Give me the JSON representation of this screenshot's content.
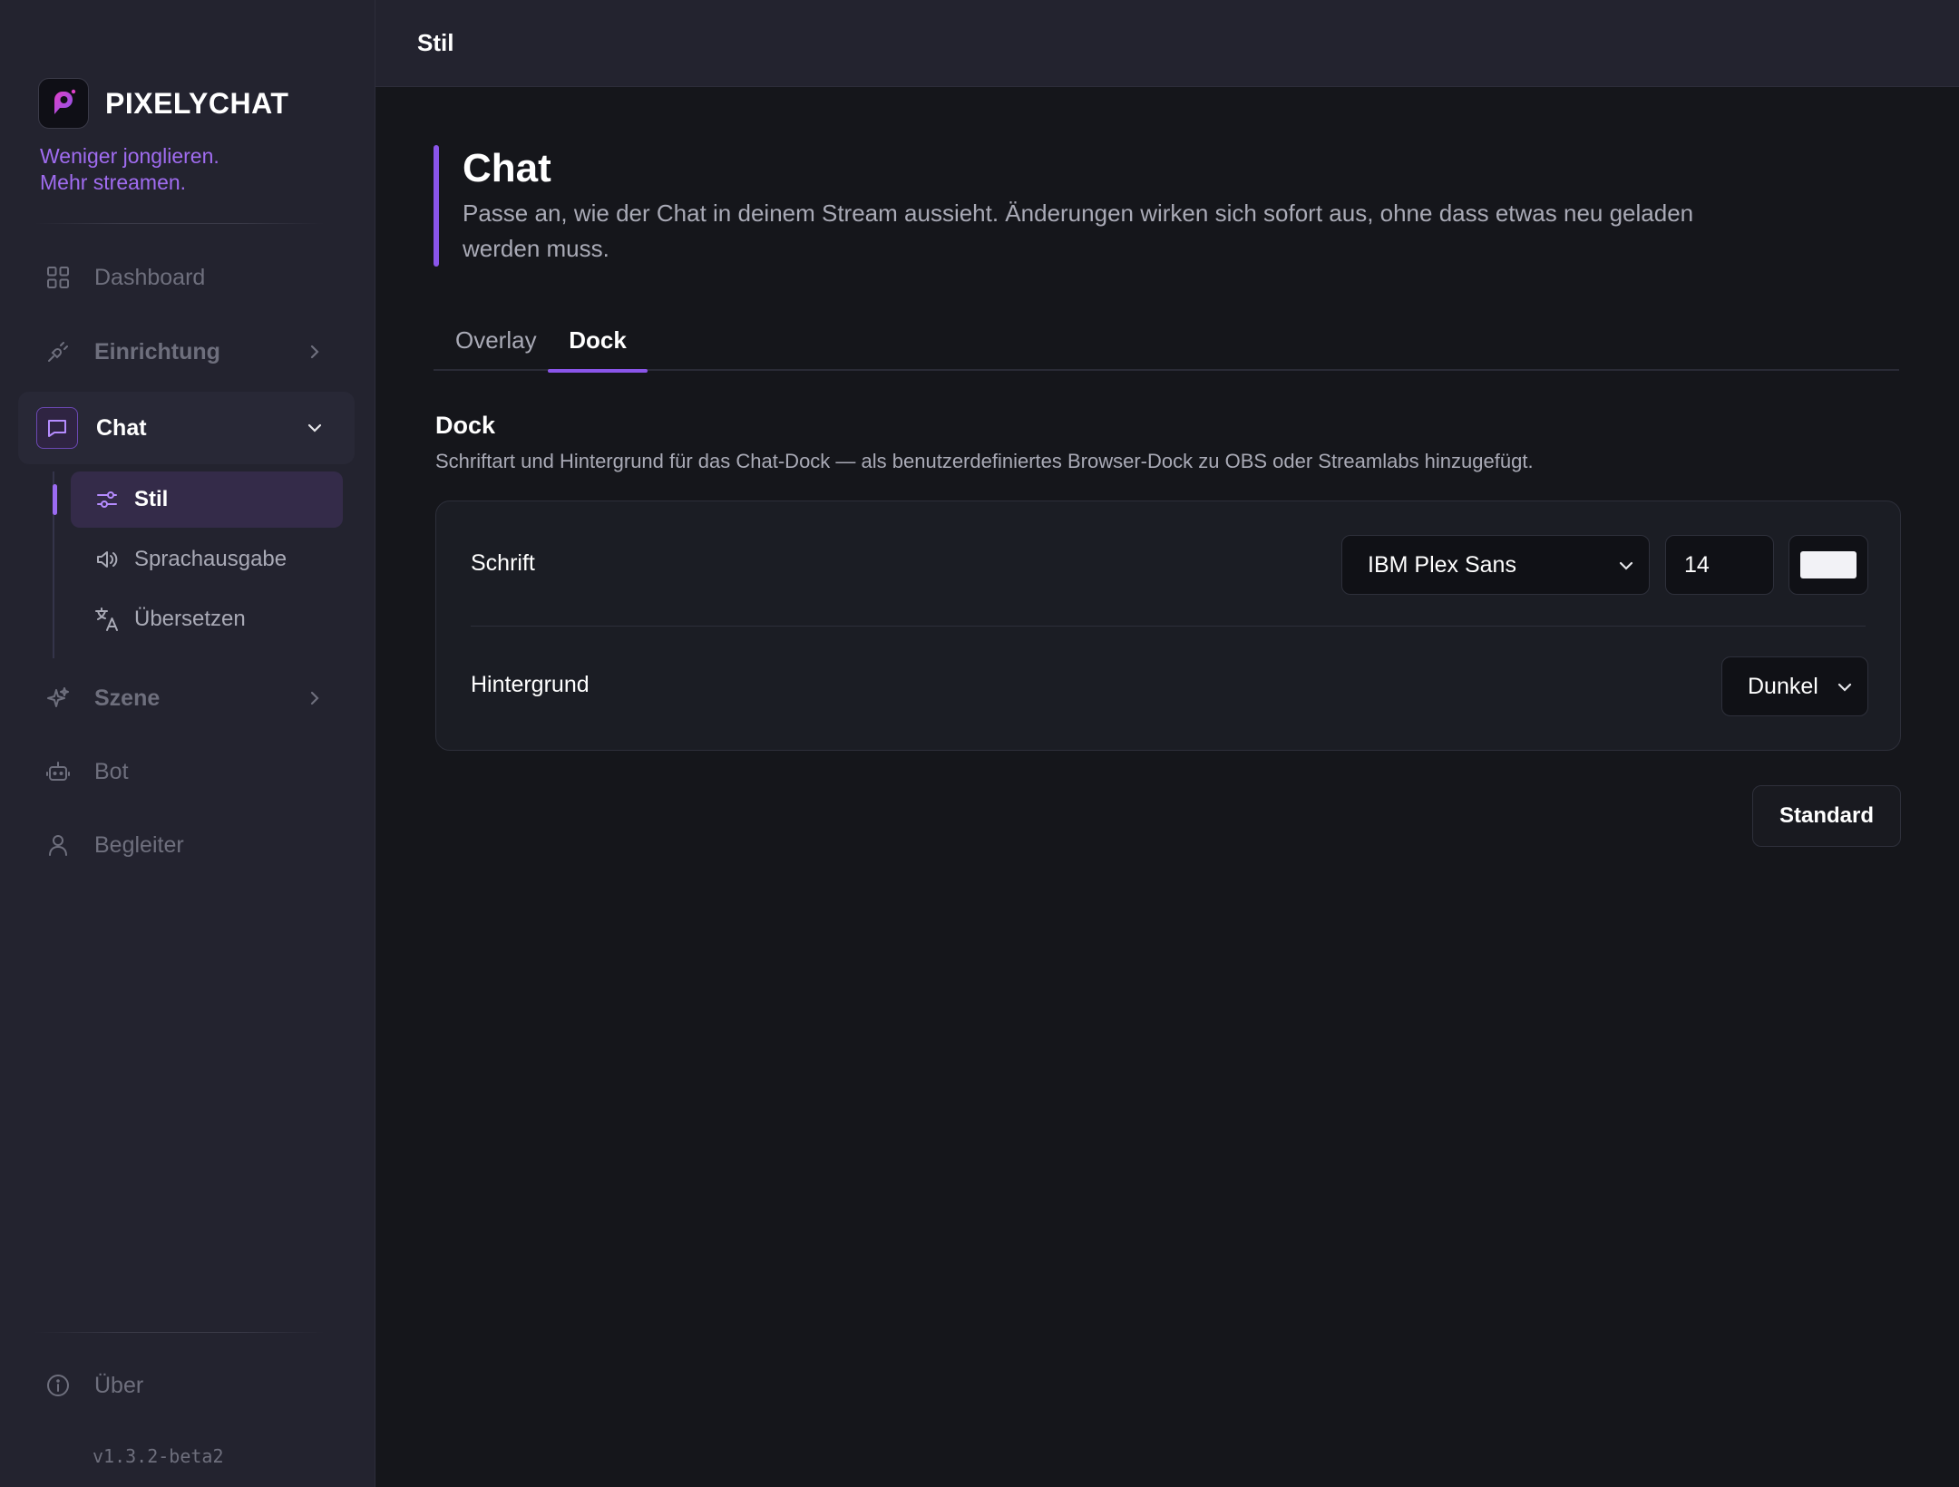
{
  "brand": {
    "name": "PIXELYCHAT",
    "tagline_line1": "Weniger jonglieren.",
    "tagline_line2": "Mehr streamen.",
    "accent_color": "#8a55ea"
  },
  "sidebar": {
    "items": [
      {
        "label": "Dashboard",
        "icon": "grid-icon"
      },
      {
        "label": "Einrichtung",
        "icon": "plug-icon"
      },
      {
        "label": "Chat",
        "icon": "chat-bubble-icon"
      },
      {
        "label": "Szene",
        "icon": "sparkle-icon"
      },
      {
        "label": "Bot",
        "icon": "robot-icon"
      },
      {
        "label": "Begleiter",
        "icon": "user-icon"
      }
    ],
    "chat_sub": [
      {
        "label": "Stil",
        "icon": "sliders-icon"
      },
      {
        "label": "Sprachausgabe",
        "icon": "speaker-icon"
      },
      {
        "label": "Übersetzen",
        "icon": "translate-icon"
      }
    ],
    "about_label": "Über",
    "version": "v1.3.2-beta2"
  },
  "topbar": {
    "title": "Stil"
  },
  "page": {
    "title": "Chat",
    "description": "Passe an, wie der Chat in deinem Stream aussieht. Änderungen wirken sich sofort aus, ohne dass etwas neu geladen werden muss."
  },
  "tabs": [
    {
      "label": "Overlay",
      "active": false
    },
    {
      "label": "Dock",
      "active": true
    }
  ],
  "section": {
    "title": "Dock",
    "description": "Schriftart und Hintergrund für das Chat-Dock — als benutzerdefiniertes Browser-Dock zu OBS oder Streamlabs hinzugefügt."
  },
  "settings": {
    "font": {
      "label": "Schrift",
      "family": "IBM Plex Sans",
      "size": "14",
      "color": "#f2f2f6"
    },
    "background": {
      "label": "Hintergrund",
      "value": "Dunkel"
    }
  },
  "actions": {
    "reset_label": "Standard"
  }
}
